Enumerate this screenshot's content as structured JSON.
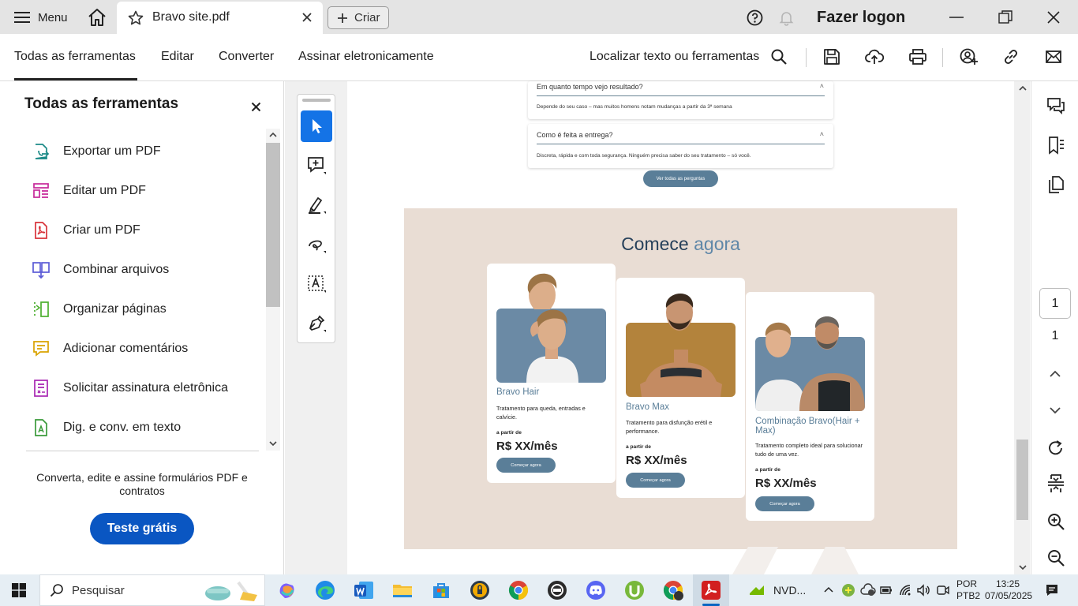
{
  "titlebar": {
    "menu_label": "Menu",
    "tab_title": "Bravo site.pdf",
    "create_label": "Criar",
    "login_label": "Fazer logon"
  },
  "toolbar": {
    "items": [
      "Todas as ferramentas",
      "Editar",
      "Converter",
      "Assinar eletronicamente"
    ],
    "search_label": "Localizar texto ou ferramentas"
  },
  "left_panel": {
    "title": "Todas as ferramentas",
    "tools": [
      {
        "label": "Exportar um PDF",
        "icon": "export-pdf-icon",
        "color": "#1b8a87"
      },
      {
        "label": "Editar um PDF",
        "icon": "edit-pdf-icon",
        "color": "#c7289a"
      },
      {
        "label": "Criar um PDF",
        "icon": "create-pdf-icon",
        "color": "#d8333a"
      },
      {
        "label": "Combinar arquivos",
        "icon": "combine-files-icon",
        "color": "#5b5bd6"
      },
      {
        "label": "Organizar páginas",
        "icon": "organize-pages-icon",
        "color": "#4caf2e"
      },
      {
        "label": "Adicionar comentários",
        "icon": "add-comment-icon",
        "color": "#d9a300"
      },
      {
        "label": "Solicitar assinatura eletrônica",
        "icon": "request-signature-icon",
        "color": "#a826b2"
      },
      {
        "label": "Dig. e conv. em texto",
        "icon": "scan-ocr-icon",
        "color": "#3a9a3a"
      }
    ],
    "promo_text": "Converta, edite e assine formulários PDF e contratos",
    "trial_button": "Teste grátis"
  },
  "document": {
    "faq": [
      {
        "question": "Em quanto tempo vejo resultado?",
        "answer": "Depende do seu caso – mas muitos homens notam mudanças a partir da 3ª semana"
      },
      {
        "question": "Como é feita a entrega?",
        "answer": "Discreta, rápida e com toda segurança. Ninguém precisa saber do seu tratamento – só você."
      }
    ],
    "faq_button": "Ver todas as perguntas",
    "cta_title_prefix": "Comece",
    "cta_title_accent": "agora",
    "cards": [
      {
        "name": "Bravo Hair",
        "desc": "Tratamento para queda, entradas e calvície.",
        "from": "a partir de",
        "price": "R$ XX/mês",
        "button": "Começar agora",
        "photo_bg": "#6b8aa5"
      },
      {
        "name": "Bravo Max",
        "desc": "Tratamento para disfunção erétil e performance.",
        "from": "a partir de",
        "price": "R$ XX/mês",
        "button": "Começar agora",
        "photo_bg": "#b3833c"
      },
      {
        "name": "Combinação Bravo(Hair + Max)",
        "desc": "Tratamento completo ideal para solucionar tudo de uma vez.",
        "from": "a partir de",
        "price": "R$ XX/mês",
        "button": "Começar agora",
        "photo_bg": "#6b8aa5"
      }
    ]
  },
  "right_panel": {
    "current_page": "1",
    "total_pages": "1"
  },
  "taskbar": {
    "search_placeholder": "Pesquisar",
    "nvidia_label": "NVD...",
    "lang_line1": "POR",
    "lang_line2": "PTB2",
    "time": "13:25",
    "date": "07/05/2025"
  },
  "colors": {
    "accent_blue": "#0a56c2",
    "selected_tool": "#1473e6",
    "pdf_slate": "#5a7e98",
    "cta_background": "#e9ddd4"
  }
}
